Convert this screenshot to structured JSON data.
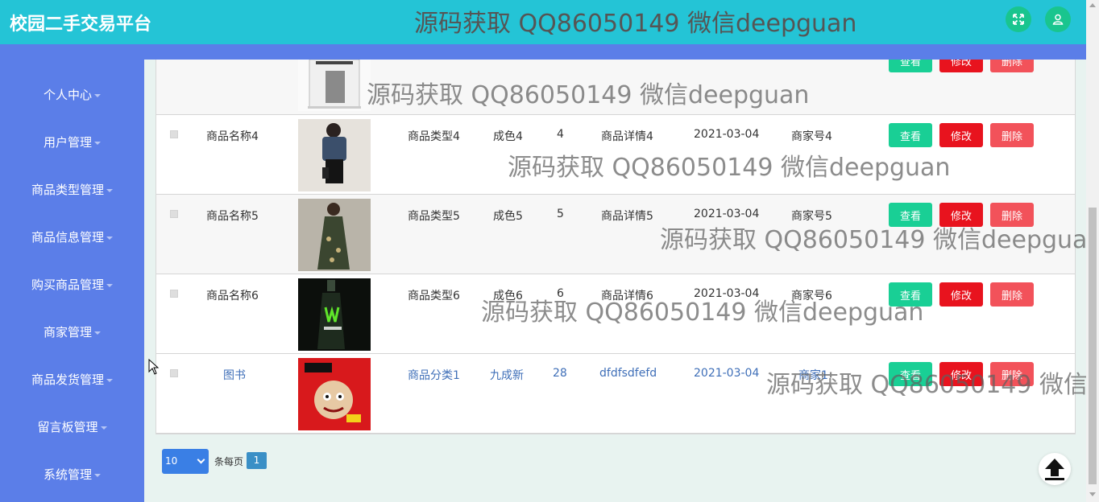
{
  "header": {
    "brand": "校园二手交易平台",
    "icons": [
      "fullscreen-icon",
      "user-icon"
    ],
    "color": "#24c4d6"
  },
  "sidebar": {
    "color": "#5b7ee8",
    "items": [
      {
        "label": "个人中心"
      },
      {
        "label": "用户管理"
      },
      {
        "label": "商品类型管理"
      },
      {
        "label": "商品信息管理"
      },
      {
        "label": "购买商品管理"
      },
      {
        "label": "商家管理"
      },
      {
        "label": "商品发货管理"
      },
      {
        "label": "留言板管理"
      },
      {
        "label": "系统管理"
      }
    ]
  },
  "table": {
    "actions": {
      "view": "查看",
      "edit": "修改",
      "delete": "删除"
    },
    "rows": [
      {
        "name": "商品名称4",
        "image": "woman-denim-jacket-photo",
        "type": "商品类型4",
        "condition": "成色4",
        "price": "4",
        "detail": "商品详情4",
        "date": "2021-03-04",
        "merchant": "商家号4"
      },
      {
        "name": "商品名称5",
        "image": "woman-floral-dress-photo",
        "type": "商品类型5",
        "condition": "成色5",
        "price": "5",
        "detail": "商品详情5",
        "date": "2021-03-04",
        "merchant": "商家号5"
      },
      {
        "name": "商品名称6",
        "image": "monster-energy-bottle-photo",
        "type": "商品类型6",
        "condition": "成色6",
        "price": "6",
        "detail": "商品详情6",
        "date": "2021-03-04",
        "merchant": "商家号6"
      },
      {
        "name": "图书",
        "image": "comic-book-cover-photo",
        "type": "商品分类1",
        "condition": "九成新",
        "price": "28",
        "detail": "dfdfsdfefd",
        "date": "2021-03-04",
        "merchant": "商家1"
      }
    ]
  },
  "pagination": {
    "page_size": "10",
    "per_page_label": "条每页",
    "current_page": "1"
  },
  "watermark": "源码获取 QQ86050149 微信deepguan"
}
